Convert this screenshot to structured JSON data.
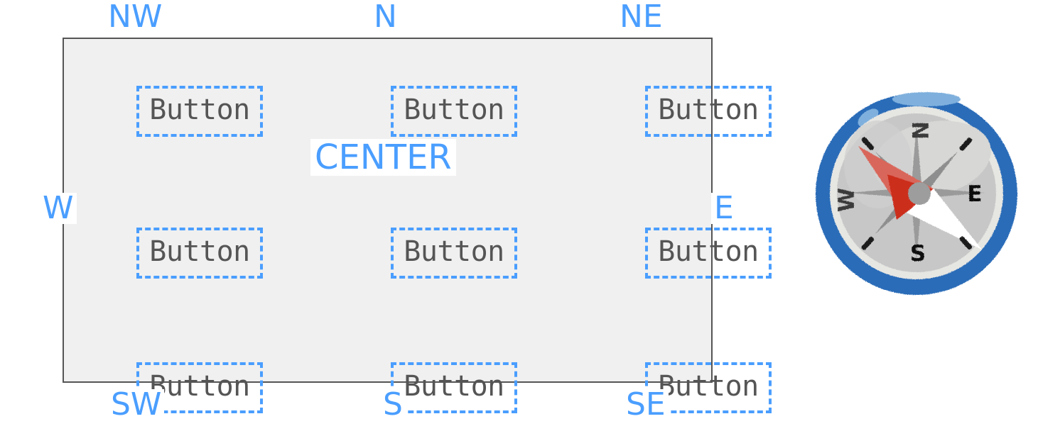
{
  "layout": {
    "container_name": "nine-region-layout",
    "background_color": "#f0f0f0",
    "border_color": "#555555",
    "accent_color": "#4a9eff",
    "button_text_color": "#555555"
  },
  "buttons": [
    {
      "id": "nw",
      "label": "Button"
    },
    {
      "id": "n",
      "label": "Button"
    },
    {
      "id": "ne",
      "label": "Button"
    },
    {
      "id": "w",
      "label": "Button"
    },
    {
      "id": "center",
      "label": "Button"
    },
    {
      "id": "e",
      "label": "Button"
    },
    {
      "id": "sw",
      "label": "Button"
    },
    {
      "id": "s",
      "label": "Button"
    },
    {
      "id": "se",
      "label": "Button"
    }
  ],
  "anchors": {
    "nw": "NW",
    "n": "N",
    "ne": "NE",
    "w": "W",
    "center": "CENTER",
    "e": "E",
    "sw": "SW",
    "s": "S",
    "se": "SE"
  },
  "compass": {
    "name": "compass-illustration",
    "cardinal_labels": {
      "north": "N",
      "east": "E",
      "south": "S",
      "west": "W"
    },
    "ring_color": "#2b6cb8",
    "ring_highlight_color": "#7fb0dd",
    "bezel_color": "#e3e3e1",
    "face_color": "#c9c9c9",
    "face_highlight_color": "#d8d8d6",
    "rose_color": "#9a9a9a",
    "needle_north_color": "#cc2e1f",
    "needle_north_light_color": "#d9665a",
    "needle_south_color": "#ffffff",
    "pivot_color": "#9d9d9d",
    "needle_heading": "NW-SE"
  }
}
